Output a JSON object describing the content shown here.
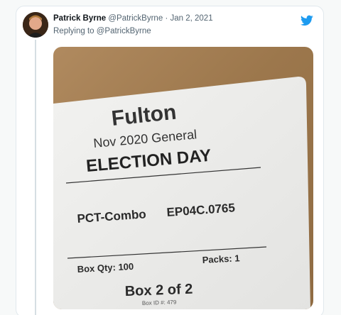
{
  "tweet": {
    "author_name": "Patrick Byrne",
    "author_handle": "@PatrickByrne",
    "separator": "·",
    "date": "Jan 2, 2021",
    "reply_prefix": "Replying to",
    "reply_handle": "@PatrickByrne",
    "icon": "twitter-bird-icon"
  },
  "photo": {
    "label": {
      "county": "Fulton",
      "election": "Nov 2020 General",
      "type": "ELECTION DAY",
      "precinct_label": "PCT-Combo",
      "precinct_code": "EP04C.0765",
      "box_qty": "Box Qty: 100",
      "packs": "Packs: 1",
      "box_number": "Box 2 of 2",
      "box_id": "Box ID #:  479"
    }
  },
  "colors": {
    "accent": "#1d9bf0",
    "card_border": "#e1e8ed",
    "cardboard": "#a07a4e"
  }
}
